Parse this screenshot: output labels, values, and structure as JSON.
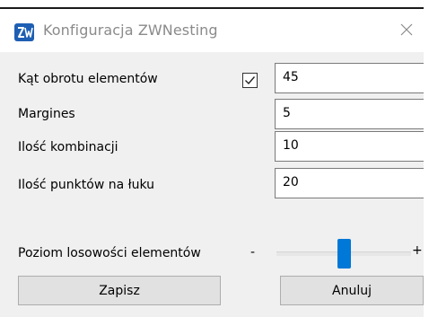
{
  "window": {
    "title": "Konfiguracja ZWNesting",
    "app_icon": "zwnesting-app-icon",
    "close_icon": "close-icon"
  },
  "fields": [
    {
      "label": "Kąt obrotu elementów",
      "value": "45",
      "checked": true
    },
    {
      "label": "Margines",
      "value": "5"
    },
    {
      "label": "Ilość kombinacji",
      "value": "10"
    },
    {
      "label": "Ilość punktów na łuku",
      "value": "20"
    }
  ],
  "slider": {
    "label": "Poziom losowości elementów",
    "minus": "-",
    "plus": "+",
    "level_fraction": 0.5
  },
  "buttons": {
    "save": "Zapisz",
    "cancel": "Anuluj"
  },
  "colors": {
    "accent": "#0078d7",
    "background": "#f0f0f0"
  }
}
